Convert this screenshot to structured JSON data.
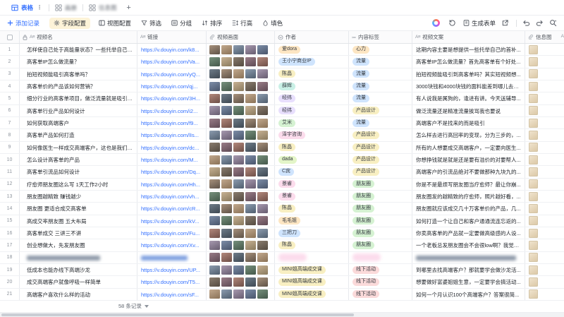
{
  "tabs": {
    "table": "表格",
    "gallery": "画册",
    "infographic": "信息图",
    "add": "+"
  },
  "toolbar": {
    "add_record": "添加记录",
    "field_config": "字段配置",
    "view_config": "视图配置",
    "filter": "筛选",
    "group": "分组",
    "sort": "排序",
    "row_height": "行高",
    "fill_color": "填色",
    "generate_form": "生成表单"
  },
  "colors": {
    "accent": "#3370ff",
    "field_config_highlight": "#fdf3d8",
    "pill": {
      "orange": "#fde6c3",
      "blue": "#cfe4fd",
      "yellow": "#f8efc2",
      "green": "#d5f2d2",
      "teal": "#c9f0e6",
      "purple": "#e8dffd",
      "pink": "#fcdcec",
      "red": "#fbdada",
      "lime": "#e3f5c8",
      "gray": "#e8eaed"
    }
  },
  "table": {
    "columns": [
      {
        "label": "视频名",
        "type": "text"
      },
      {
        "label": "链接",
        "type": "text"
      },
      {
        "label": "视频画面",
        "type": "attachment"
      },
      {
        "label": "作者",
        "type": "single-select"
      },
      {
        "label": "内容标签",
        "type": "multi-select"
      },
      {
        "label": "视频文案",
        "type": "text"
      },
      {
        "label": "信息图",
        "type": "attachment"
      }
    ],
    "next_column_peek": "A",
    "record_count": "58 条记录",
    "rows": [
      {
        "n": 1,
        "name": "怎样使自己处于高能量状态？一些托举自己的...",
        "link": "https://v.douyin.com/k8...",
        "author": "爱dora",
        "ac": "orange",
        "tag": "心力",
        "tc": "orange",
        "copy": "这期内容主要是想提供一些托举自己的首补...",
        "redacted": false
      },
      {
        "n": 2,
        "name": "高客单IP怎么做流量？",
        "link": "https://v.douyin.com/Va...",
        "author": "王小宁商业IP",
        "ac": "blue",
        "tag": "流量",
        "tc": "blue",
        "copy": "高客单IP怎么做流量？首先高客单有个好处...",
        "redacted": false
      },
      {
        "n": 3,
        "name": "拍短视频能吸引高客单吗？",
        "link": "https://v.douyin.com/yQ...",
        "author": "陈晶",
        "ac": "yellow",
        "tag": "流量",
        "tc": "blue",
        "copy": "拍短视频能吸引到高客单吗？其实短视频想...",
        "redacted": false
      },
      {
        "n": 4,
        "name": "高客单价的产品该如何营销？",
        "link": "https://v.douyin.com/qj...",
        "author": "薛辉",
        "ac": "teal",
        "tag": "流量",
        "tc": "blue",
        "copy": "3000块钱和4000块钱的面料能差到哪儿去呢...",
        "redacted": false
      },
      {
        "n": 5,
        "name": "细分行业的高客单项目，做泛流量就是吸引不...",
        "link": "https://v.douyin.com/3H...",
        "author": "经纬",
        "ac": "purple",
        "tag": "流量",
        "tc": "blue",
        "copy": "有人说我是属狗的，逢进有讲。今天送辅导...",
        "redacted": false
      },
      {
        "n": 6,
        "name": "高客单行业产品如何设计",
        "link": "https://v.douyin.com/i2...",
        "author": "经纬",
        "ac": "purple",
        "tag": "产品设计",
        "tc": "yellow",
        "copy": "做泛流量还是精准流量挨骂我也要说",
        "redacted": false
      },
      {
        "n": 7,
        "name": "如何获取高端客户",
        "link": "https://v.douyin.com/f9...",
        "author": "艾米",
        "ac": "green",
        "tag": "流量",
        "tc": "blue",
        "copy": "高端客户不是找来的而是吸引",
        "redacted": false
      },
      {
        "n": 8,
        "name": "高客单产品如何打造",
        "link": "https://v.douyin.com/lIs...",
        "author": "泽宇咨询",
        "ac": "pink",
        "tag": "产品设计",
        "tc": "yellow",
        "copy": "怎么样去进行高回率的变现，分为三步的，...",
        "redacted": false
      },
      {
        "n": 9,
        "name": "如何像医生一样成交高端客户，这也是我们的...",
        "link": "https://v.douyin.com/dc...",
        "author": "陈晶",
        "ac": "yellow",
        "tag": "产品设计",
        "tc": "yellow",
        "copy": "所有的人想要成交高端客户，一定要向医生...",
        "redacted": false
      },
      {
        "n": 10,
        "name": "怎么设计高客单的产品",
        "link": "https://v.douyin.com/M...",
        "author": "dada",
        "ac": "lime",
        "tag": "产品设计",
        "tc": "yellow",
        "copy": "你想挣钱就是就是还是要有溢价的对要帮人...",
        "redacted": false
      },
      {
        "n": 11,
        "name": "高客单引流品如何设计",
        "link": "https://v.douyin.com/Dq...",
        "author": "C宾",
        "ac": "blue",
        "tag": "产品设计",
        "tc": "yellow",
        "copy": "高端客户的引流品绝对不要做那种九块九的...",
        "redacted": false
      },
      {
        "n": 12,
        "name": "疗愈师朋友圈这么写 1天工作2小时",
        "link": "https://v.douyin.com/Hh...",
        "author": "景睿",
        "ac": "pink",
        "tag": "朋友圈",
        "tc": "green",
        "copy": "你是不是最烦写朋友圈当疗愈师？最让你崩...",
        "redacted": false
      },
      {
        "n": 13,
        "name": "朋友圈越精致 赚钱越少",
        "link": "https://v.douyin.com/vh...",
        "author": "景睿",
        "ac": "pink",
        "tag": "朋友圈",
        "tc": "green",
        "copy": "朋友圈发的越精致的疗愈师，照片越好看，...",
        "redacted": false
      },
      {
        "n": 14,
        "name": "朋友圈 更适合成交高客单",
        "link": "https://v.douyin.com/cR...",
        "author": "陈晶",
        "ac": "yellow",
        "tag": "朋友圈",
        "tc": "green",
        "copy": "朋友圈就应该成交几十万客单价的产品，几...",
        "redacted": false
      },
      {
        "n": 15,
        "name": "高成交率朋友圈 五大布局",
        "link": "https://v.douyin.com/kV...",
        "author": "毛毛姐",
        "ac": "orange",
        "tag": "朋友圈",
        "tc": "green",
        "copy": "如何打造一个让自己和客户通通流连忘返的...",
        "redacted": false
      },
      {
        "n": 16,
        "name": "高客单成交 三讲三不讲",
        "link": "https://v.douyin.com/Fu...",
        "author": "三把刀",
        "ac": "blue",
        "tag": "朋友圈",
        "tc": "green",
        "copy": "你卖高客单的产品就一定要做高级感的人设...",
        "redacted": false
      },
      {
        "n": 17,
        "name": "创业想做大，先发朋友圈",
        "link": "https://v.douyin.com/Xv...",
        "author": "陈晶",
        "ac": "yellow",
        "tag": "朋友圈",
        "tc": "green",
        "copy": "一个老板总发朋友圈会不会很low啊？我觉得...",
        "redacted": false
      },
      {
        "n": 18,
        "name": "",
        "link": "",
        "author": "",
        "ac": "pink",
        "tag": "",
        "tc": "pink",
        "copy": "",
        "redacted": true
      },
      {
        "n": 19,
        "name": "低成本也能办线下高端沙龙",
        "link": "https://v.douyin.com/UP...",
        "author": "MINI姐高端成交课",
        "ac": "yellow",
        "tag": "线下活动",
        "tc": "red",
        "copy": "到哪里去找高端客户？那就要学会做沙龙活...",
        "redacted": false
      },
      {
        "n": 20,
        "name": "成交高端客户就像呼吸一样简单",
        "link": "https://v.douyin.com/T5...",
        "author": "MINI姐高端成交课",
        "ac": "yellow",
        "tag": "线下活动",
        "tc": "red",
        "copy": "想要做好富婆姐姐生意，一定要学会搞活动...",
        "redacted": false
      },
      {
        "n": 21,
        "name": "高端客户喜欢什么样的活动",
        "link": "https://v.douyin.com/sF...",
        "author": "MINI姐高端成交课",
        "ac": "yellow",
        "tag": "线下活动",
        "tc": "red",
        "copy": "如何一个月认识100个高端客户？答案很简...",
        "redacted": false
      }
    ]
  }
}
